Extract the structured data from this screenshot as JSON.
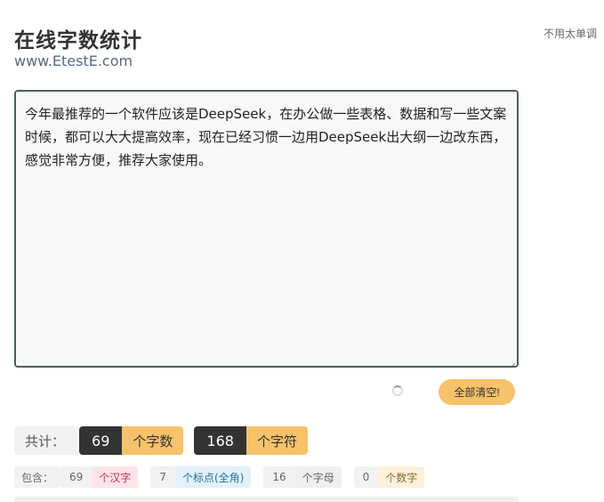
{
  "header": {
    "title": "在线字数统计",
    "subtitle": "www.EtestE.com",
    "top_link": "不用太单调"
  },
  "editor": {
    "text": "今年最推荐的一个软件应该是DeepSeek，在办公做一些表格、数据和写一些文案时候，都可以大大提高效率，现在已经习惯一边用DeepSeek出大纲一边改东西，感觉非常方便，推荐大家使用。"
  },
  "actions": {
    "clear_label": "全部清空!"
  },
  "stats": {
    "total_label": "共计：",
    "words_count": "69",
    "words_unit": "个字数",
    "chars_count": "168",
    "chars_unit": "个字符"
  },
  "detail": {
    "label": "包含：",
    "chinese_count": "69",
    "chinese_unit": "个汉字",
    "punct_count": "7",
    "punct_unit": "个标点(全角)",
    "letters_count": "16",
    "letters_unit": "个字母",
    "digits_count": "0",
    "digits_unit": "个数字"
  },
  "colors": {
    "accent": "#f6c26a",
    "dark": "#333333",
    "editor_border": "#4b5f5f"
  }
}
